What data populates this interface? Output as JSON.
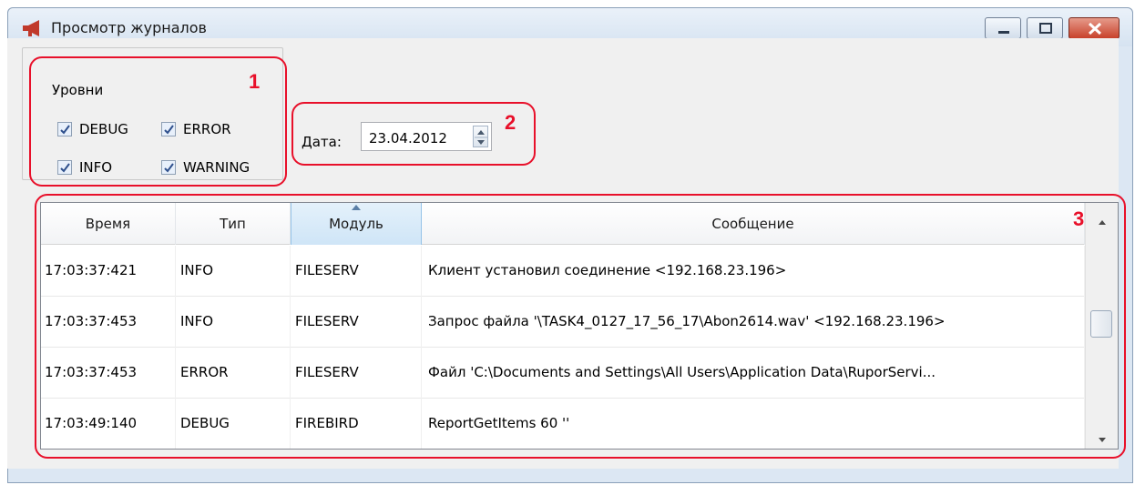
{
  "window": {
    "title": "Просмотр журналов",
    "accent_color": "#c0392b"
  },
  "levels": {
    "legend": "Уровни",
    "items": [
      {
        "label": "DEBUG",
        "checked": true
      },
      {
        "label": "ERROR",
        "checked": true
      },
      {
        "label": "INFO",
        "checked": true
      },
      {
        "label": "WARNING",
        "checked": true
      }
    ]
  },
  "date": {
    "label": "Дата:",
    "value": "23.04.2012"
  },
  "table": {
    "columns": [
      "Время",
      "Тип",
      "Модуль",
      "Сообщение"
    ],
    "sorted_column": "Модуль",
    "rows": [
      [
        "17:03:37:421",
        "INFO",
        "FILESERV",
        "Клиент установил соединение <192.168.23.196>"
      ],
      [
        "17:03:37:453",
        "INFO",
        "FILESERV",
        "Запрос файла '\\TASK4_0127_17_56_17\\Abon2614.wav' <192.168.23.196>"
      ],
      [
        "17:03:37:453",
        "ERROR",
        "FILESERV",
        "Файл 'C:\\Documents and Settings\\All Users\\Application Data\\RuporServi..."
      ],
      [
        "17:03:49:140",
        "DEBUG",
        "FIREBIRD",
        "ReportGetItems 60 ''"
      ]
    ]
  },
  "annotations": {
    "labels": [
      "1",
      "2",
      "3"
    ],
    "color": "#e8102a"
  }
}
